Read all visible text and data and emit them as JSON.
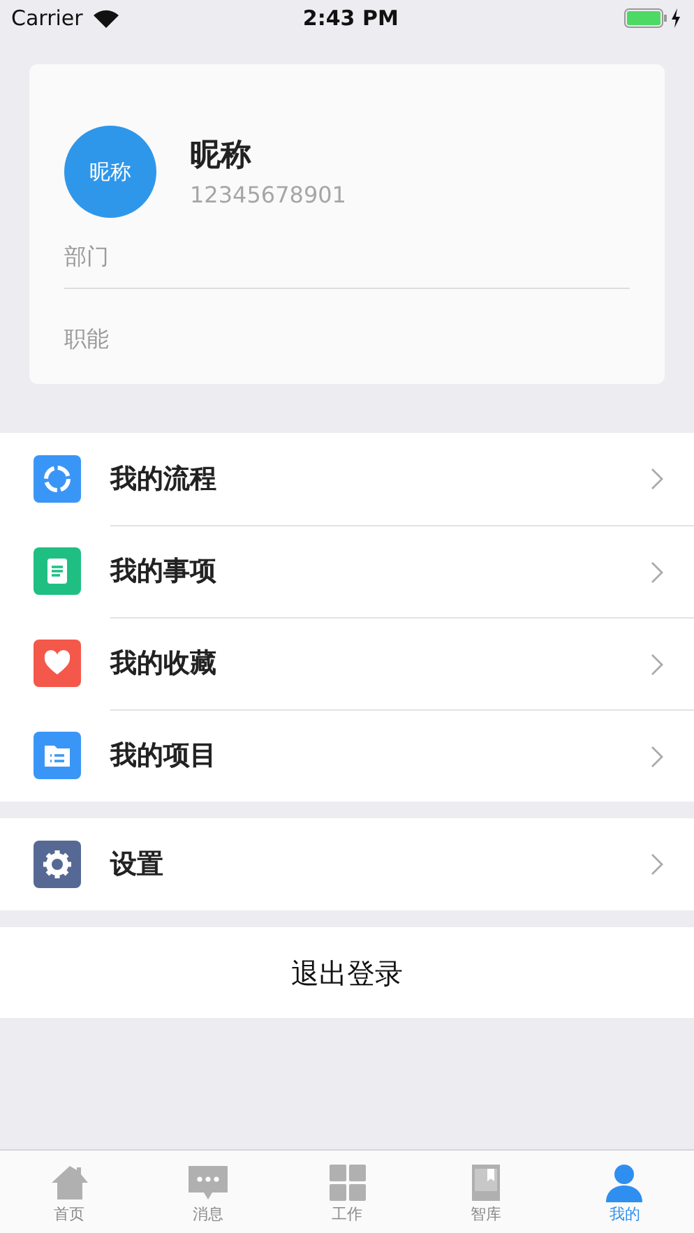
{
  "status_bar": {
    "carrier": "Carrier",
    "time": "2:43 PM"
  },
  "profile": {
    "avatar_text": "昵称",
    "nickname": "昵称",
    "phone": "12345678901",
    "fields": [
      "部门",
      "职能"
    ]
  },
  "menu_groups": [
    {
      "items": [
        {
          "label": "我的流程",
          "kind": "cycle",
          "color": "#3a96f6"
        },
        {
          "label": "我的事项",
          "kind": "document",
          "color": "#1fbf83"
        },
        {
          "label": "我的收藏",
          "kind": "heart",
          "color": "#f4584a"
        },
        {
          "label": "我的项目",
          "kind": "folder",
          "color": "#3a96f6"
        }
      ]
    },
    {
      "items": [
        {
          "label": "设置",
          "kind": "gear",
          "color": "#566995"
        }
      ]
    }
  ],
  "logout_button": "退出登录",
  "tab_bar": [
    {
      "label": "首页",
      "kind": "home",
      "selected": false
    },
    {
      "label": "消息",
      "kind": "message",
      "selected": false
    },
    {
      "label": "工作",
      "kind": "grid",
      "selected": false
    },
    {
      "label": "智库",
      "kind": "book",
      "selected": false
    },
    {
      "label": "我的",
      "kind": "person",
      "selected": true
    }
  ]
}
